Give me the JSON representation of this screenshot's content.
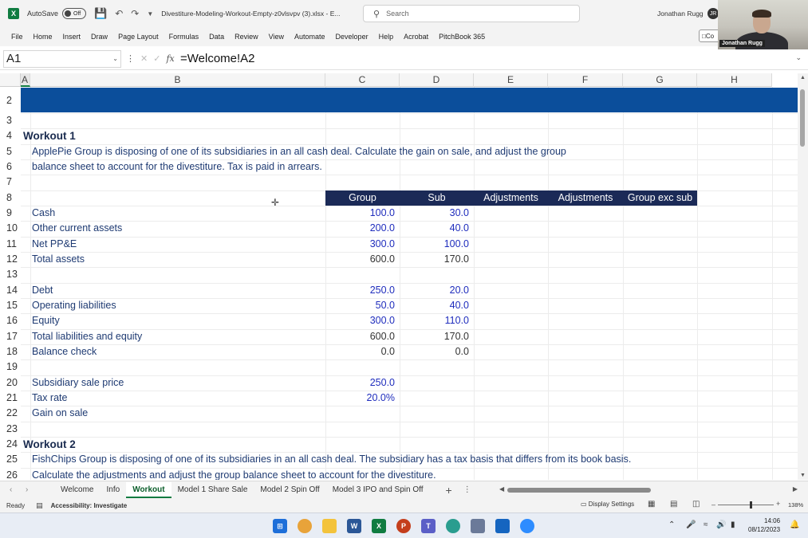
{
  "titlebar": {
    "app_letter": "X",
    "autosave_label": "AutoSave",
    "autosave_state": "Off",
    "doc_title": "Divestiture-Modeling-Workout-Empty-z0vlsvpv (3).xlsx  -  E...",
    "search_placeholder": "Search",
    "user_name": "Jonathan Rugg",
    "user_initials": "JR"
  },
  "webcam": {
    "name_tag": "Jonathan Rugg"
  },
  "menu": [
    "File",
    "Home",
    "Insert",
    "Draw",
    "Page Layout",
    "Formulas",
    "Data",
    "Review",
    "View",
    "Automate",
    "Developer",
    "Help",
    "Acrobat",
    "PitchBook 365"
  ],
  "comments_label": "Co",
  "formula_bar": {
    "name_box": "A1",
    "fx_label": "fx",
    "formula": "=Welcome!A2"
  },
  "columns": [
    "A",
    "B",
    "C",
    "D",
    "E",
    "F",
    "G",
    "H"
  ],
  "rows": [
    "2",
    "3",
    "4",
    "5",
    "6",
    "7",
    "8",
    "9",
    "10",
    "11",
    "12",
    "13",
    "14",
    "15",
    "16",
    "17",
    "18",
    "19",
    "20",
    "21",
    "22",
    "23",
    "24",
    "25",
    "26"
  ],
  "sheet": {
    "workout1_title": "Workout 1",
    "workout1_desc1": "ApplePie Group is disposing of one of its subsidiaries in an all cash deal. Calculate the gain on sale, and adjust the group",
    "workout1_desc2": "balance sheet to account for the divestiture. Tax is paid in arrears.",
    "table_headers": [
      "Group",
      "Sub",
      "Adjustments",
      "Adjustments",
      "Group exc sub"
    ],
    "line_items": [
      {
        "label": "Cash",
        "group": "100.0",
        "sub": "30.0",
        "input": true
      },
      {
        "label": "Other current assets",
        "group": "200.0",
        "sub": "40.0",
        "input": true
      },
      {
        "label": "Net PP&E",
        "group": "300.0",
        "sub": "100.0",
        "input": true
      },
      {
        "label": "Total assets",
        "group": "600.0",
        "sub": "170.0",
        "input": false
      },
      {
        "label": "Debt",
        "group": "250.0",
        "sub": "20.0",
        "input": true
      },
      {
        "label": "Operating liabilities",
        "group": "50.0",
        "sub": "40.0",
        "input": true
      },
      {
        "label": "Equity",
        "group": "300.0",
        "sub": "110.0",
        "input": true
      },
      {
        "label": "Total liabilities and equity",
        "group": "600.0",
        "sub": "170.0",
        "input": false
      },
      {
        "label": "Balance check",
        "group": "0.0",
        "sub": "0.0",
        "input": false
      }
    ],
    "sale_price_label": "Subsidiary sale price",
    "sale_price_value": "250.0",
    "tax_rate_label": "Tax rate",
    "tax_rate_value": "20.0%",
    "gain_label": "Gain on sale",
    "workout2_title": "Workout 2",
    "workout2_desc1": "FishChips Group is disposing of one of its subsidiaries in an all cash deal. The subsidiary has a tax basis that differs from its book basis.",
    "workout2_desc2": "Calculate the adjustments and adjust the group balance sheet to account for the divestiture."
  },
  "sheet_tabs": [
    "Welcome",
    "Info",
    "Workout",
    "Model 1 Share Sale",
    "Model 2 Spin Off",
    "Model 3 IPO and Spin Off"
  ],
  "active_tab": "Workout",
  "status": {
    "ready": "Ready",
    "accessibility": "Accessibility: Investigate",
    "display_settings": "Display Settings",
    "zoom": "138%"
  },
  "clock": {
    "time": "14:06",
    "date": "08/12/2023"
  },
  "colors": {
    "excel_green": "#107c41",
    "banner_blue": "#0b4e9b",
    "header_navy": "#1b2a57",
    "input_blue": "#1f2dbd"
  }
}
